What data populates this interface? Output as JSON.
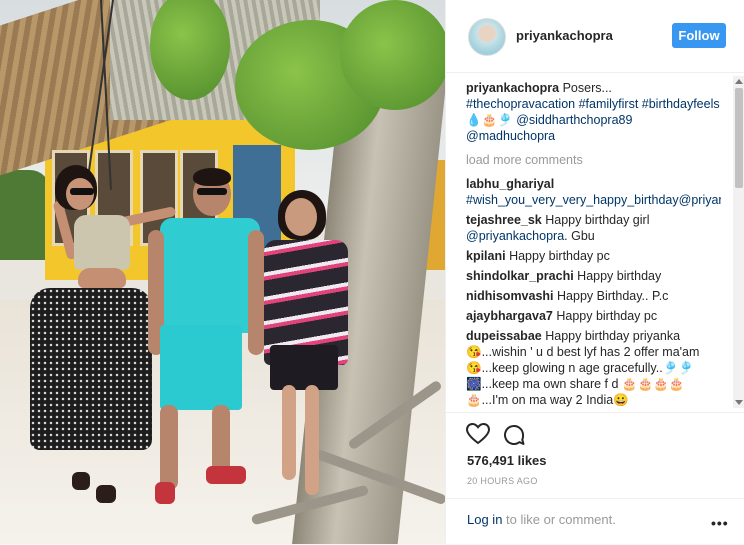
{
  "post": {
    "username": "priyankachopra",
    "follow_label": "Follow",
    "caption": {
      "author": "priyankachopra",
      "text": "Posers...",
      "hashtags": "#thechopravacation #familyfirst #birthdayfeels",
      "emoji": "💧🎂🎐",
      "mentions": "@siddharthchopra89 @madhuchopra"
    },
    "load_more_label": "load more comments",
    "comments": [
      {
        "user": "labhu_ghariyal",
        "text_tag": "#wish_you_very_very_happy_birthday",
        "text": "@priyankachopra"
      },
      {
        "user": "tejashree_sk",
        "text": "Happy birthday girl",
        "text_tag": "@priyankachopra",
        "text_tail": ". Gbu"
      },
      {
        "user": "kpilani",
        "text": "Happy birthday pc"
      },
      {
        "user": "shindolkar_prachi",
        "text": "Happy birthday"
      },
      {
        "user": "nidhisomvashi",
        "text": "Happy Birthday.. P.c"
      },
      {
        "user": "ajaybhargava7",
        "text": "Happy birthday pc"
      },
      {
        "user": "dupeissabae",
        "text": "Happy birthday priyanka",
        "lines": [
          "😘...wishin ' u d best lyf has 2 offer ma'am",
          "😘...keep glowing n age gracefully..🎐🎐",
          "🎆...keep ma own share f d 🎂🎂🎂🎂🎂...I'm on ma way 2 India😀"
        ]
      }
    ],
    "likes": "576,491 likes",
    "timestamp": "20 HOURS AGO",
    "login_link": "Log in",
    "login_rest": " to like or comment.",
    "more_label": "•••"
  },
  "icons": [
    "heart-icon",
    "comment-icon",
    "more-options-icon"
  ]
}
